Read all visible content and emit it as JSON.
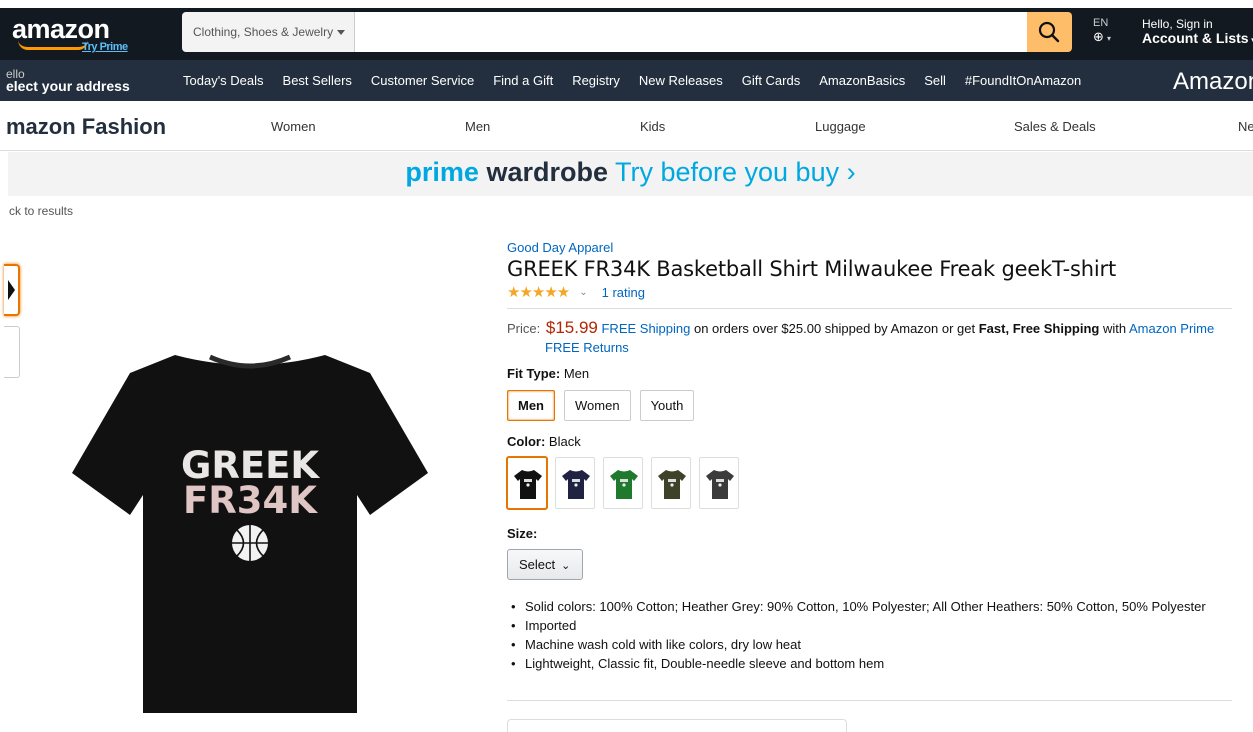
{
  "header": {
    "logo_text": "amazon",
    "logo_sub": "Try Prime",
    "search_dept": "Clothing, Shoes & Jewelry",
    "search_value": "",
    "lang": "EN",
    "account_greeting": "Hello, Sign in",
    "account_label": "Account & Lists"
  },
  "nav": {
    "address_hello": "ello",
    "address_label": "elect your address",
    "links": [
      "Today's Deals",
      "Best Sellers",
      "Customer Service",
      "Find a Gift",
      "Registry",
      "New Releases",
      "Gift Cards",
      "AmazonBasics",
      "Sell",
      "#FoundItOnAmazon"
    ],
    "promo": "Amazon"
  },
  "subnav": {
    "brand": "mazon Fashion",
    "categories": [
      "Women",
      "Men",
      "Kids",
      "Luggage",
      "Sales & Deals",
      "Ne"
    ]
  },
  "banner": {
    "prime": "prime",
    "wardrobe": "wardrobe",
    "tagline": "Try before you buy",
    "arrow": "›"
  },
  "back_link": "ck to results",
  "product": {
    "brand": "Good Day Apparel",
    "title": "GREEK FR34K Basketball Shirt Milwaukee Freak geekT-shirt",
    "stars": "★★★★★",
    "rating_count": "1 rating",
    "price_label": "Price:",
    "price": "$15.99",
    "free_shipping": "FREE Shipping",
    "shipping_text": " on orders over $25.00 shipped by Amazon or get ",
    "fast_free": "Fast, Free Shipping",
    "with_text": " with ",
    "amazon_prime": "Amazon Prime",
    "free_returns": "FREE Returns",
    "fit_label": "Fit Type:",
    "fit_value": "Men",
    "fit_options": [
      "Men",
      "Women",
      "Youth"
    ],
    "color_label": "Color:",
    "color_value": "Black",
    "color_swatches": [
      "#111111",
      "#1f2240",
      "#1f7a2e",
      "#3d4229",
      "#3b3b3b"
    ],
    "size_label": "Size:",
    "size_select": "Select",
    "bullets": [
      "Solid colors: 100% Cotton; Heather Grey: 90% Cotton, 10% Polyester; All Other Heathers: 50% Cotton, 50% Polyester",
      "Imported",
      "Machine wash cold with like colors, dry low heat",
      "Lightweight, Classic fit, Double-needle sleeve and bottom hem"
    ],
    "shirt_line1": "GREEK",
    "shirt_line2": "FR34K"
  },
  "colors": {
    "nav_dark": "#131921",
    "nav_mid": "#232f3e",
    "accent_orange": "#febd69",
    "link_blue": "#0066c0",
    "price_red": "#b12704",
    "prime_blue": "#00a8e1"
  }
}
